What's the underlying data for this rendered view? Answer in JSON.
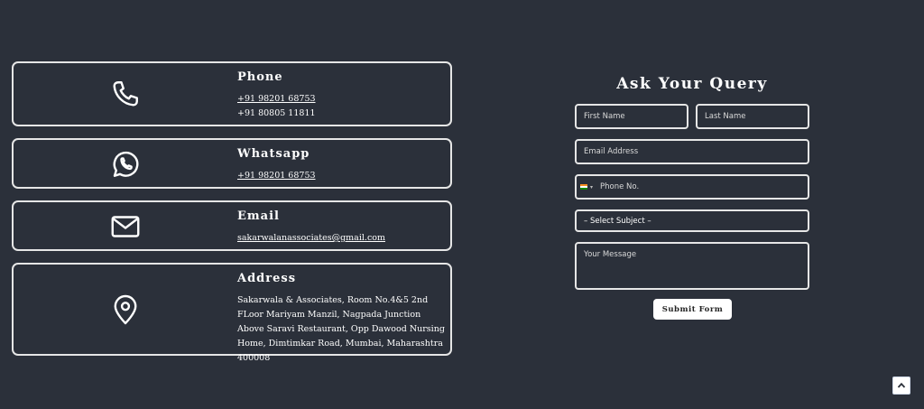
{
  "contact": {
    "phone": {
      "icon": "phone-icon",
      "title": "Phone",
      "numbers": [
        "+91 98201 68753",
        "+91 80805 11811"
      ]
    },
    "whatsapp": {
      "icon": "whatsapp-icon",
      "title": "Whatsapp",
      "number": "+91 98201 68753"
    },
    "email": {
      "icon": "mail-icon",
      "title": "Email",
      "address": "sakarwalanassociates@gmail.com"
    },
    "address": {
      "icon": "map-pin-icon",
      "title": "Address",
      "text": "Sakarwala & Associates, Room No.4&5 2nd FLoor Mariyam Manzil, Nagpada Junction Above Saravi Restaurant, Opp Dawood Nursing Home, Dimtimkar Road, Mumbai, Maharashtra 400008"
    }
  },
  "form": {
    "title": "Ask Your Query",
    "first_name_placeholder": "First Name",
    "last_name_placeholder": "Last Name",
    "email_placeholder": "Email Address",
    "phone_placeholder": "Phone No.",
    "phone_country_icon": "india-flag-icon",
    "subject_selected": "– Select Subject –",
    "message_placeholder": "Your Message",
    "submit_label": "Submit Form"
  },
  "scroll_top_icon": "chevron-up-icon",
  "colors": {
    "background": "#2b303a",
    "border": "#e6e6e6",
    "text": "#ffffff"
  }
}
